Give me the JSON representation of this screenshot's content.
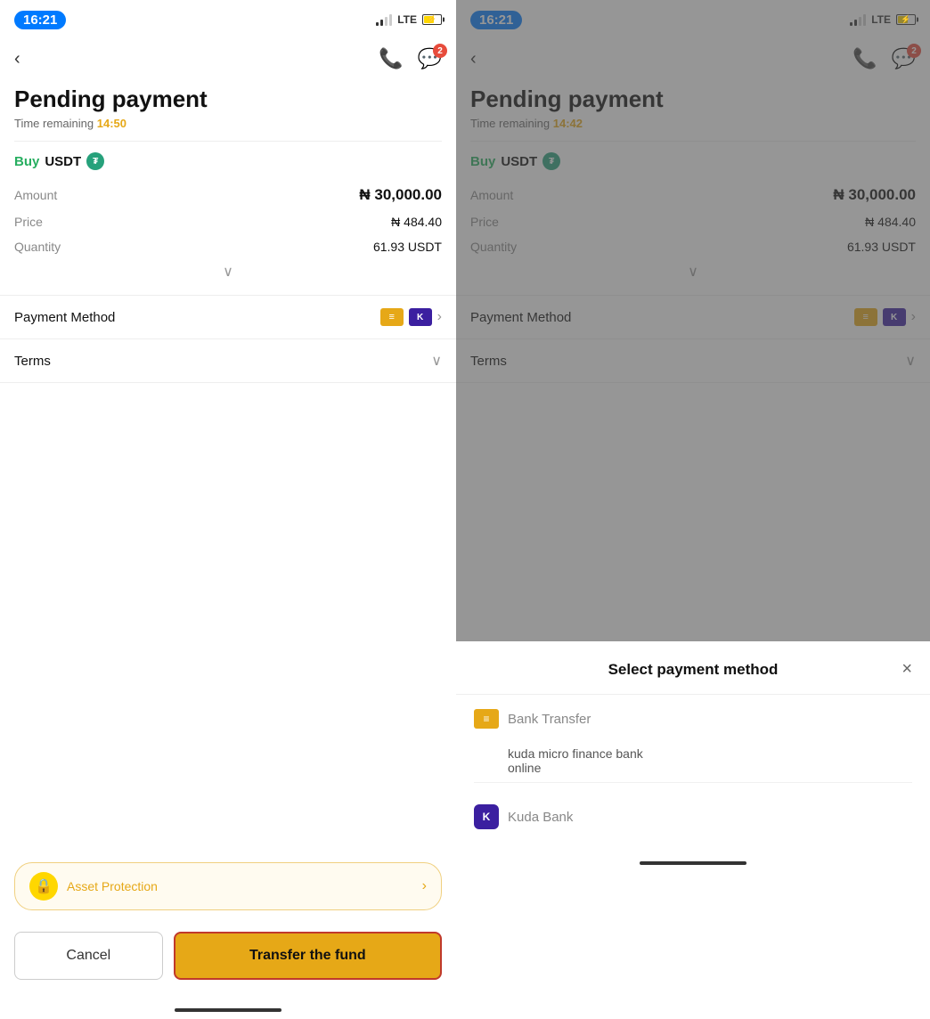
{
  "left": {
    "statusBar": {
      "time": "16:21",
      "lte": "LTE",
      "signalBars": [
        4,
        7,
        10,
        13
      ],
      "badgeCount": "2"
    },
    "title": "Pending payment",
    "timeRemaining": {
      "label": "Time remaining",
      "value": "14:50"
    },
    "transaction": {
      "action": "Buy",
      "asset": "USDT",
      "amount": {
        "label": "Amount",
        "value": "₦ 30,000.00"
      },
      "price": {
        "label": "Price",
        "value": "₦ 484.40"
      },
      "quantity": {
        "label": "Quantity",
        "value": "61.93 USDT"
      }
    },
    "paymentMethod": {
      "label": "Payment Method"
    },
    "terms": {
      "label": "Terms"
    },
    "assetProtection": {
      "label": "Asset Protection"
    },
    "buttons": {
      "cancel": "Cancel",
      "transfer": "Transfer the fund"
    }
  },
  "right": {
    "statusBar": {
      "time": "16:21",
      "lte": "LTE",
      "badgeCount": "2"
    },
    "title": "Pending payment",
    "timeRemaining": {
      "label": "Time remaining",
      "value": "14:42"
    },
    "transaction": {
      "action": "Buy",
      "asset": "USDT",
      "amount": {
        "label": "Amount",
        "value": "₦ 30,000.00"
      },
      "price": {
        "label": "Price",
        "value": "₦ 484.40"
      },
      "quantity": {
        "label": "Quantity",
        "value": "61.93 USDT"
      }
    },
    "paymentMethod": {
      "label": "Payment Method"
    },
    "terms": {
      "label": "Terms"
    },
    "bottomSheet": {
      "title": "Select payment method",
      "closeLabel": "×",
      "bankTransfer": {
        "label": "Bank Transfer",
        "subItem1": "kuda micro finance bank",
        "subItem2": "online"
      },
      "kudaBank": {
        "label": "Kuda Bank"
      }
    }
  }
}
